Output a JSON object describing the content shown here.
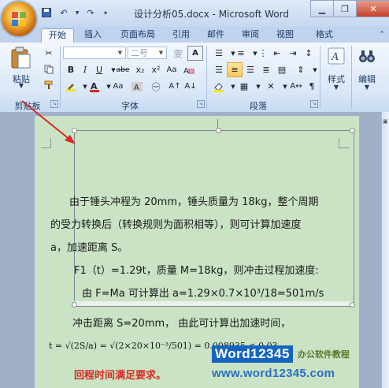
{
  "titlebar": {
    "title": "设计分析05.docx - Microsoft Word",
    "qat": [
      "save",
      "undo",
      "redo",
      "customize"
    ],
    "controls": [
      "minimize",
      "restore",
      "close"
    ]
  },
  "tabs": [
    {
      "label": "开始",
      "active": true
    },
    {
      "label": "插入"
    },
    {
      "label": "页面布局"
    },
    {
      "label": "引用"
    },
    {
      "label": "邮件"
    },
    {
      "label": "审阅"
    },
    {
      "label": "视图"
    },
    {
      "label": "格式"
    }
  ],
  "ribbon": {
    "clipboard": {
      "label": "剪贴板",
      "paste_label": "粘贴"
    },
    "font": {
      "label": "字体",
      "font_name_placeholder": "",
      "font_size_value": "二号",
      "style_buttons": [
        "B",
        "I",
        "U",
        "abe",
        "x₂",
        "x²",
        "A"
      ],
      "text_color": "#d62a22",
      "highlight_color": "#f2e31b"
    },
    "paragraph": {
      "label": "段落"
    },
    "styles": {
      "label": "样式"
    },
    "editing": {
      "label": "编辑"
    }
  },
  "document": {
    "p1": "由于锤头冲程为 20mm，锤头质量为 18kg，整个周期",
    "p2": "的受力转换后（转换规则为面积相等），则可计算加速度",
    "p3": "a，加速距离 S。",
    "p4": "F1（t）=1.29t，质量 M=18kg，则冲击过程加速度:",
    "p5": "由 F=Ma    可计算出 a=1.29×0.7×10³/18=501m/s",
    "p6": "冲击距离  S=20mm， 由此可计算出加速时间，",
    "formula": "t = √(2S/a) = √(2×20×10⁻³/501) = 0.008935 < 0.03",
    "p7": "回程时间满足要求。",
    "page_bg": "#c9e3c4"
  },
  "watermark": {
    "brand": "Word12345",
    "tagline": "办公软件教程",
    "url": "www.word12345.com"
  }
}
